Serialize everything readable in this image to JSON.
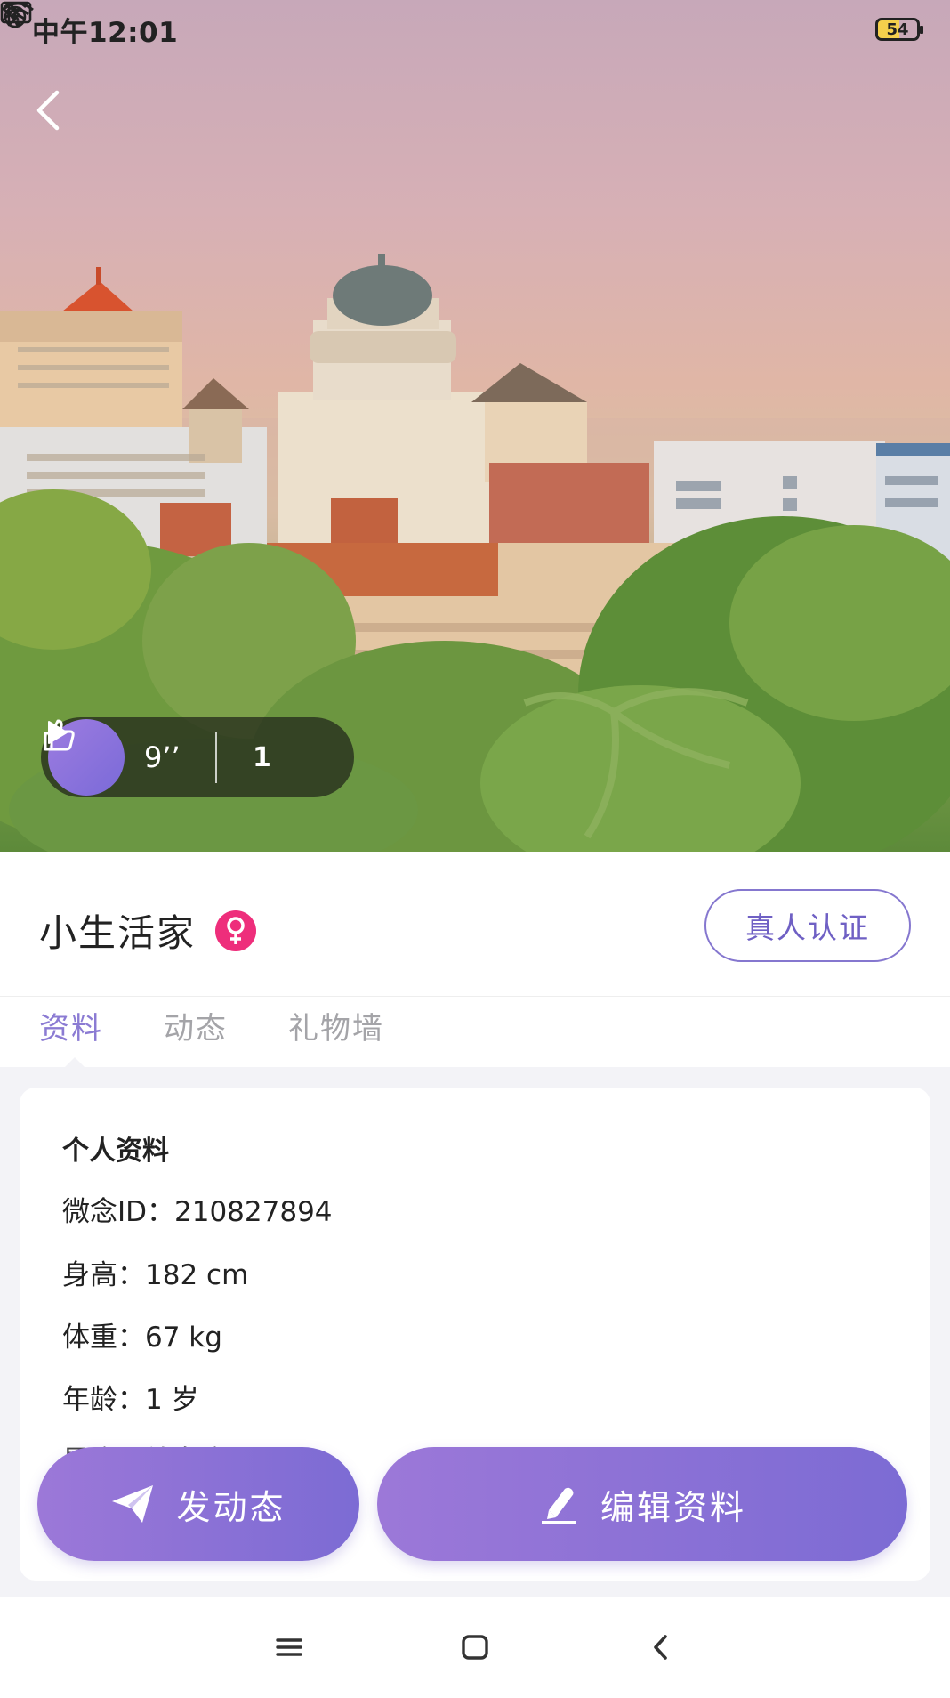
{
  "status_bar": {
    "time": "中午12:01",
    "battery": "54",
    "icons": [
      "bluetooth-icon",
      "alarm-icon",
      "sim-off-icon",
      "wifi-icon",
      "battery-icon"
    ]
  },
  "hero": {
    "duration": "9’’",
    "like_count": "1"
  },
  "profile": {
    "username": "小生活家",
    "gender_symbol": "♀",
    "verify_label": "真人认证"
  },
  "tabs": [
    {
      "label": "资料",
      "active": true
    },
    {
      "label": "动态",
      "active": false
    },
    {
      "label": "礼物墙",
      "active": false
    }
  ],
  "info": {
    "title": "个人资料",
    "lines": [
      "微念ID：210827894",
      "身高：182 cm",
      "体重：67 kg",
      "年龄：1 岁",
      "星座：处女座"
    ]
  },
  "actions": {
    "post_label": "发动态",
    "edit_label": "编辑资料"
  },
  "colors": {
    "accent": "#8b7bd3",
    "button_gradient_start": "#9c78d8",
    "button_gradient_end": "#7c6bd4",
    "gender_badge": "#ee2e7b"
  }
}
